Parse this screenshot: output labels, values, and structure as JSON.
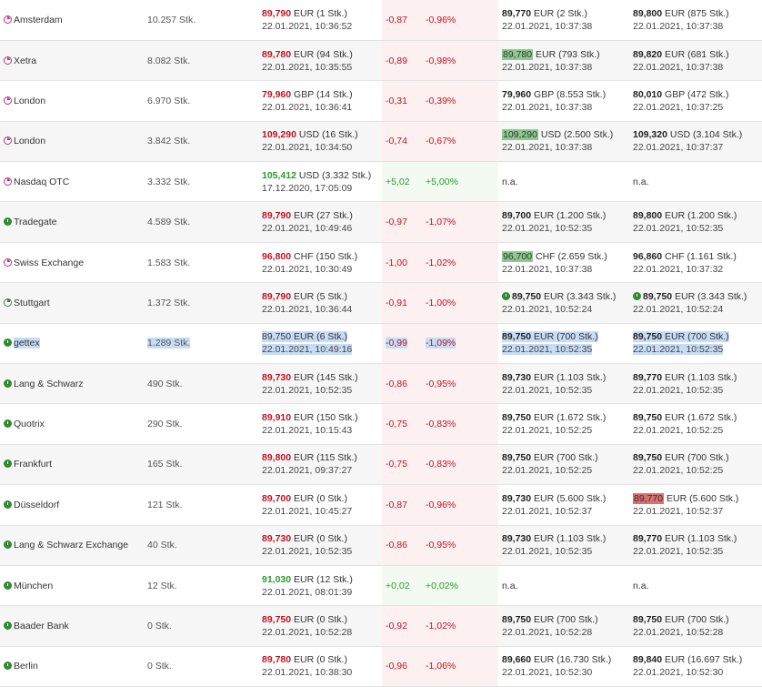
{
  "rows": [
    {
      "exchange": "Amsterdam",
      "marker": "pink",
      "volume": "10.257 Stk.",
      "last_price": "89,790",
      "last_vol": "EUR (1 Stk.)",
      "last_time": "22.01.2021, 10:36:52",
      "trend": "neg",
      "chg_abs": "-0,87",
      "chg_pct": "-0,96%",
      "bid_price": "89,770",
      "bid_rest": "EUR (2 Stk.)",
      "bid_time": "22.01.2021, 10:37:38",
      "ask_price": "89,800",
      "ask_rest": "EUR (875 Stk.)",
      "ask_time": "22.01.2021, 10:37:38"
    },
    {
      "exchange": "Xetra",
      "marker": "pink",
      "volume": "8.082 Stk.",
      "last_price": "89,780",
      "last_vol": "EUR (94 Stk.)",
      "last_time": "22.01.2021, 10:35:55",
      "trend": "neg",
      "chg_abs": "-0,89",
      "chg_pct": "-0,98%",
      "bid_price": "89,780",
      "bid_rest": "EUR (793 Stk.)",
      "bid_time": "22.01.2021, 10:37:38",
      "bid_hl": "green",
      "ask_price": "89,820",
      "ask_rest": "EUR (681 Stk.)",
      "ask_time": "22.01.2021, 10:37:38"
    },
    {
      "exchange": "London",
      "marker": "pink",
      "volume": "6.970 Stk.",
      "last_price": "79,960",
      "last_vol": "GBP (14 Stk.)",
      "last_time": "22.01.2021, 10:36:41",
      "trend": "neg",
      "chg_abs": "-0,31",
      "chg_pct": "-0,39%",
      "bid_price": "79,960",
      "bid_rest": "GBP (8.553 Stk.)",
      "bid_time": "22.01.2021, 10:37:38",
      "ask_price": "80,010",
      "ask_rest": "GBP (472 Stk.)",
      "ask_time": "22.01.2021, 10:37:25"
    },
    {
      "exchange": "London",
      "marker": "pink",
      "volume": "3.842 Stk.",
      "last_price": "109,290",
      "last_vol": "USD (16 Stk.)",
      "last_time": "22.01.2021, 10:34:50",
      "trend": "neg",
      "chg_abs": "-0,74",
      "chg_pct": "-0,67%",
      "bid_price": "109,290",
      "bid_rest": "USD (2.500 Stk.)",
      "bid_time": "22.01.2021, 10:37:38",
      "bid_hl": "green",
      "ask_price": "109,320",
      "ask_rest": "USD (3.104 Stk.)",
      "ask_time": "22.01.2021, 10:37:37"
    },
    {
      "exchange": "Nasdaq OTC",
      "marker": "pink",
      "volume": "3.332 Stk.",
      "last_price": "105,412",
      "last_vol": "USD (3.332 Stk.)",
      "last_time": "17.12.2020, 17:05:09",
      "trend": "pos",
      "chg_abs": "+5,02",
      "chg_pct": "+5,00%",
      "bid_na": "n.a.",
      "ask_na": "n.a."
    },
    {
      "exchange": "Tradegate",
      "marker": "green",
      "volume": "4.589 Stk.",
      "last_price": "89,790",
      "last_vol": "EUR (27 Stk.)",
      "last_time": "22.01.2021, 10:49:46",
      "trend": "neg",
      "chg_abs": "-0,97",
      "chg_pct": "-1,07%",
      "bid_price": "89,700",
      "bid_rest": "EUR (1.200 Stk.)",
      "bid_time": "22.01.2021, 10:52:35",
      "ask_price": "89,800",
      "ask_rest": "EUR (1.200 Stk.)",
      "ask_time": "22.01.2021, 10:52:35"
    },
    {
      "exchange": "Swiss Exchange",
      "marker": "pink",
      "volume": "1.583 Stk.",
      "last_price": "96,800",
      "last_vol": "CHF (150 Stk.)",
      "last_time": "22.01.2021, 10:30:49",
      "trend": "neg",
      "chg_abs": "-1,00",
      "chg_pct": "-1,02%",
      "bid_price": "96,700",
      "bid_rest": "CHF (2.659 Stk.)",
      "bid_time": "22.01.2021, 10:37:38",
      "bid_hl": "green",
      "ask_price": "96,860",
      "ask_rest": "CHF (1.161 Stk.)",
      "ask_time": "22.01.2021, 10:37:32"
    },
    {
      "exchange": "Stuttgart",
      "marker": "greenring",
      "volume": "1.372 Stk.",
      "last_price": "89,790",
      "last_vol": "EUR (5 Stk.)",
      "last_time": "22.01.2021, 10:36:44",
      "trend": "neg",
      "chg_abs": "-0,91",
      "chg_pct": "-1,00%",
      "bid_price": "89,750",
      "bid_rest": "EUR (3.343 Stk.)",
      "bid_time": "22.01.2021, 10:52:24",
      "bid_icon": true,
      "ask_price": "89,750",
      "ask_rest": "EUR (3.343 Stk.)",
      "ask_time": "22.01.2021, 10:52:24",
      "ask_icon": true
    },
    {
      "exchange": "gettex",
      "marker": "green",
      "volume": "1.289 Stk.",
      "last_price": "89,750",
      "last_vol": "EUR (6 Stk.)",
      "last_time": "22.01.2021, 10:49:16",
      "trend": "neg",
      "chg_abs": "-0,99",
      "chg_pct": "-1,09%",
      "bid_price": "89,750",
      "bid_rest": "EUR (700 Stk.)",
      "bid_time": "22.01.2021, 10:52:35",
      "ask_price": "89,750",
      "ask_rest": "EUR (700 Stk.)",
      "ask_time": "22.01.2021, 10:52:35",
      "selected": true
    },
    {
      "exchange": "Lang & Schwarz",
      "marker": "green",
      "volume": "490 Stk.",
      "last_price": "89,730",
      "last_vol": "EUR (145 Stk.)",
      "last_time": "22.01.2021, 10:52:35",
      "trend": "neg",
      "chg_abs": "-0,86",
      "chg_pct": "-0,95%",
      "bid_price": "89,730",
      "bid_rest": "EUR (1.103 Stk.)",
      "bid_time": "22.01.2021, 10:52:35",
      "ask_price": "89,770",
      "ask_rest": "EUR (1.103 Stk.)",
      "ask_time": "22.01.2021, 10:52:35"
    },
    {
      "exchange": "Quotrix",
      "marker": "green",
      "volume": "290 Stk.",
      "last_price": "89,910",
      "last_vol": "EUR (150 Stk.)",
      "last_time": "22.01.2021, 10:15:43",
      "trend": "neg",
      "chg_abs": "-0,75",
      "chg_pct": "-0,83%",
      "bid_price": "89,750",
      "bid_rest": "EUR (1.672 Stk.)",
      "bid_time": "22.01.2021, 10:52:25",
      "ask_price": "89,750",
      "ask_rest": "EUR (1.672 Stk.)",
      "ask_time": "22.01.2021, 10:52:25"
    },
    {
      "exchange": "Frankfurt",
      "marker": "green",
      "volume": "165 Stk.",
      "last_price": "89,800",
      "last_vol": "EUR (115 Stk.)",
      "last_time": "22.01.2021, 09:37:27",
      "trend": "neg",
      "chg_abs": "-0,75",
      "chg_pct": "-0,83%",
      "bid_price": "89,750",
      "bid_rest": "EUR (700 Stk.)",
      "bid_time": "22.01.2021, 10:52:25",
      "ask_price": "89,750",
      "ask_rest": "EUR (700 Stk.)",
      "ask_time": "22.01.2021, 10:52:25"
    },
    {
      "exchange": "Düsseldorf",
      "marker": "green",
      "volume": "121 Stk.",
      "last_price": "89,700",
      "last_vol": "EUR (0 Stk.)",
      "last_time": "22.01.2021, 10:45:27",
      "trend": "neg",
      "chg_abs": "-0,87",
      "chg_pct": "-0,96%",
      "bid_price": "89,730",
      "bid_rest": "EUR (5.600 Stk.)",
      "bid_time": "22.01.2021, 10:52:37",
      "ask_price": "89,770",
      "ask_rest": "EUR (5.600 Stk.)",
      "ask_time": "22.01.2021, 10:52:37",
      "ask_hl": "red"
    },
    {
      "exchange": "Lang & Schwarz Exchange",
      "marker": "green",
      "volume": "40 Stk.",
      "last_price": "89,730",
      "last_vol": "EUR (0 Stk.)",
      "last_time": "22.01.2021, 10:52:35",
      "trend": "neg",
      "chg_abs": "-0,86",
      "chg_pct": "-0,95%",
      "bid_price": "89,730",
      "bid_rest": "EUR (1.103 Stk.)",
      "bid_time": "22.01.2021, 10:52:35",
      "ask_price": "89,770",
      "ask_rest": "EUR (1.103 Stk.)",
      "ask_time": "22.01.2021, 10:52:35"
    },
    {
      "exchange": "München",
      "marker": "green",
      "volume": "12 Stk.",
      "last_price": "91,030",
      "last_vol": "EUR (12 Stk.)",
      "last_time": "22.01.2021, 08:01:39",
      "trend": "pos",
      "chg_abs": "+0,02",
      "chg_pct": "+0,02%",
      "bid_na": "n.a.",
      "ask_na": "n.a."
    },
    {
      "exchange": "Baader Bank",
      "marker": "green",
      "volume": "0 Stk.",
      "last_price": "89,750",
      "last_vol": "EUR (0 Stk.)",
      "last_time": "22.01.2021, 10:52:28",
      "trend": "neg",
      "chg_abs": "-0,92",
      "chg_pct": "-1,02%",
      "bid_price": "89,750",
      "bid_rest": "EUR (700 Stk.)",
      "bid_time": "22.01.2021, 10:52:28",
      "ask_price": "89,750",
      "ask_rest": "EUR (700 Stk.)",
      "ask_time": "22.01.2021, 10:52:28"
    },
    {
      "exchange": "Berlin",
      "marker": "green",
      "volume": "0 Stk.",
      "last_price": "89,780",
      "last_vol": "EUR (0 Stk.)",
      "last_time": "22.01.2021, 10:38:30",
      "trend": "neg",
      "chg_abs": "-0,96",
      "chg_pct": "-1,06%",
      "bid_price": "89,660",
      "bid_rest": "EUR (16.730 Stk.)",
      "bid_time": "22.01.2021, 10:52:30",
      "ask_price": "89,840",
      "ask_rest": "EUR (16.697 Stk.)",
      "ask_time": "22.01.2021, 10:52:30"
    }
  ],
  "colors": {
    "negative": "#c1121f",
    "positive": "#2a9a2a",
    "bid_highlight": "#8fc98f",
    "ask_highlight": "#d97070",
    "selection": "#c7dcf5"
  },
  "icons": {
    "pink": "exchange-status-pink-icon",
    "green": "exchange-status-green-icon",
    "greenring": "exchange-status-greenring-icon"
  }
}
